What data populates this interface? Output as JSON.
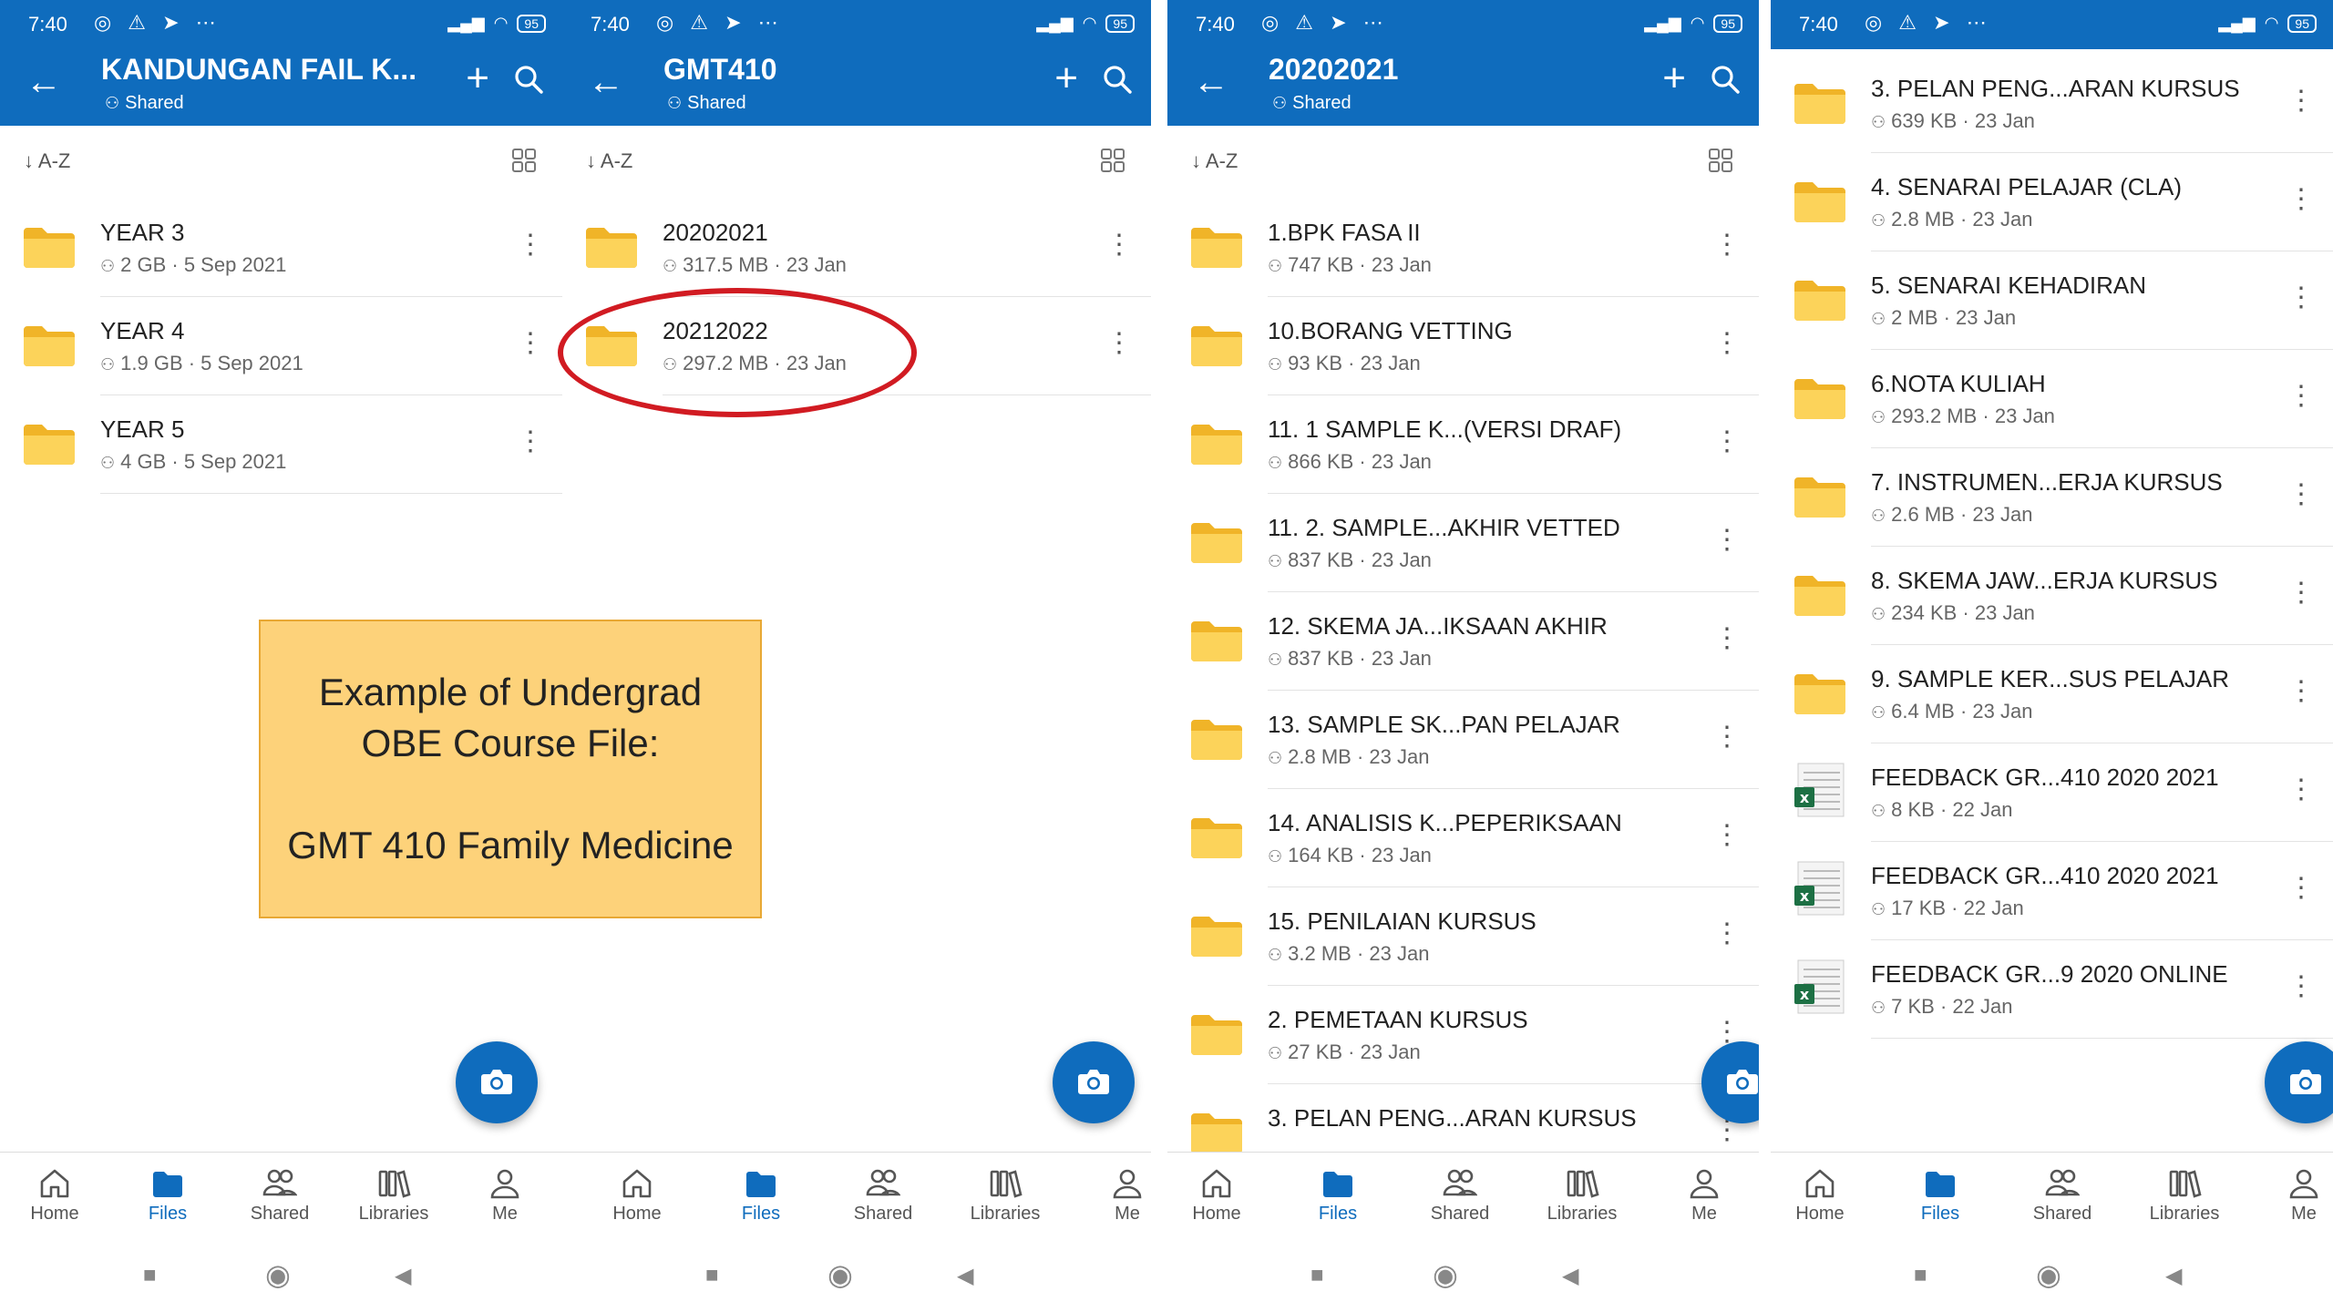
{
  "status": {
    "time": "7:40",
    "battery": "95"
  },
  "nav": {
    "home": "Home",
    "files": "Files",
    "shared": "Shared",
    "libraries": "Libraries",
    "me": "Me"
  },
  "sort_label": "A-Z",
  "callout": {
    "line1": "Example of Undergrad",
    "line2": "OBE Course File:",
    "line3": "GMT 410 Family Medicine"
  },
  "colors": {
    "brand": "#0f6cbd",
    "folder": "#f8c640",
    "highlight": "#d11b22",
    "callout_bg": "#fdd27a"
  },
  "panels": [
    {
      "title": "KANDUNGAN FAIL K...",
      "subtitle": "Shared",
      "items": [
        {
          "name": "YEAR 3",
          "meta": "2 GB · 5 Sep 2021",
          "icon": "folder-icon"
        },
        {
          "name": "YEAR 4",
          "meta": "1.9 GB · 5 Sep 2021",
          "icon": "folder-icon"
        },
        {
          "name": "YEAR 5",
          "meta": "4 GB · 5 Sep 2021",
          "icon": "folder-icon"
        }
      ]
    },
    {
      "title": "GMT410",
      "subtitle": "Shared",
      "items": [
        {
          "name": "20202021",
          "meta": "317.5 MB · 23 Jan",
          "icon": "folder-icon"
        },
        {
          "name": "20212022",
          "meta": "297.2 MB · 23 Jan",
          "icon": "folder-icon"
        }
      ]
    },
    {
      "title": "20202021",
      "subtitle": "Shared",
      "items": [
        {
          "name": "1.BPK FASA II",
          "meta": "747 KB · 23 Jan",
          "icon": "folder-icon"
        },
        {
          "name": "10.BORANG VETTING",
          "meta": "93 KB · 23 Jan",
          "icon": "folder-icon"
        },
        {
          "name": "11. 1 SAMPLE K...(VERSI DRAF)",
          "meta": "866 KB · 23 Jan",
          "icon": "folder-icon"
        },
        {
          "name": "11. 2. SAMPLE...AKHIR VETTED",
          "meta": "837 KB · 23 Jan",
          "icon": "folder-icon"
        },
        {
          "name": "12. SKEMA JA...IKSAAN AKHIR",
          "meta": "837 KB · 23 Jan",
          "icon": "folder-icon"
        },
        {
          "name": "13. SAMPLE SK...PAN PELAJAR",
          "meta": "2.8 MB · 23 Jan",
          "icon": "folder-icon"
        },
        {
          "name": "14. ANALISIS K...PEPERIKSAAN",
          "meta": "164 KB · 23 Jan",
          "icon": "folder-icon"
        },
        {
          "name": "15. PENILAIAN KURSUS",
          "meta": "3.2 MB · 23 Jan",
          "icon": "folder-icon"
        },
        {
          "name": "2. PEMETAAN KURSUS",
          "meta": "27 KB · 23 Jan",
          "icon": "folder-icon"
        },
        {
          "name": "3. PELAN PENG...ARAN KURSUS",
          "meta": "",
          "icon": "folder-icon"
        }
      ]
    },
    {
      "items": [
        {
          "name": "3. PELAN PENG...ARAN KURSUS",
          "meta": "639 KB · 23 Jan",
          "icon": "folder-icon"
        },
        {
          "name": "4. SENARAI PELAJAR (CLA)",
          "meta": "2.8 MB · 23 Jan",
          "icon": "folder-icon"
        },
        {
          "name": "5. SENARAI KEHADIRAN",
          "meta": "2 MB · 23 Jan",
          "icon": "folder-icon"
        },
        {
          "name": "6.NOTA KULIAH",
          "meta": "293.2 MB · 23 Jan",
          "icon": "folder-icon"
        },
        {
          "name": "7. INSTRUMEN...ERJA KURSUS",
          "meta": "2.6 MB · 23 Jan",
          "icon": "folder-icon"
        },
        {
          "name": "8. SKEMA JAW...ERJA KURSUS",
          "meta": "234 KB · 23 Jan",
          "icon": "folder-icon"
        },
        {
          "name": "9. SAMPLE KER...SUS PELAJAR",
          "meta": "6.4 MB · 23 Jan",
          "icon": "folder-icon"
        },
        {
          "name": "FEEDBACK GR...410 2020 2021",
          "meta": "8 KB · 22 Jan",
          "icon": "excel-file-icon"
        },
        {
          "name": "FEEDBACK GR...410 2020 2021",
          "meta": "17 KB · 22 Jan",
          "icon": "excel-file-icon"
        },
        {
          "name": "FEEDBACK GR...9 2020 ONLINE",
          "meta": "7 KB · 22 Jan",
          "icon": "excel-file-icon"
        }
      ]
    }
  ]
}
